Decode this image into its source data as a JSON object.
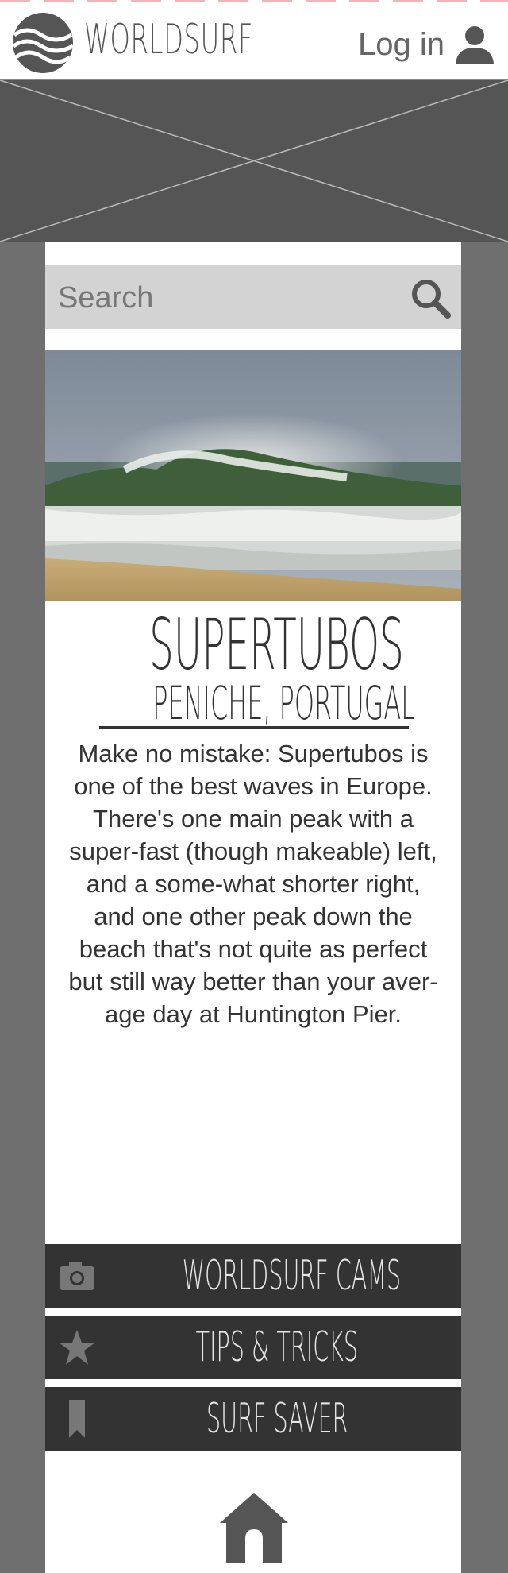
{
  "brand": {
    "name": "WORLDSURF"
  },
  "header": {
    "login_label": "Log in"
  },
  "search": {
    "placeholder": "Search"
  },
  "spot": {
    "name": "SUPERTUBOS",
    "location": "PENICHE, PORTUGAL",
    "description": "Make no mistake: Supertubos is one of the best waves in Europe. There's one main peak with a super-fast (though makeable) left, and a some-what shorter right, and one other peak down the beach that's not quite as perfect but still way better than your aver-age day at Huntington Pier."
  },
  "menu": [
    {
      "label": "WORLDSURF CAMS",
      "icon": "camera-icon"
    },
    {
      "label": "TIPS & TRICKS",
      "icon": "star-icon"
    },
    {
      "label": "SURF SAVER",
      "icon": "bookmark-icon"
    }
  ],
  "footer": {
    "icon": "home-icon"
  },
  "colors": {
    "background": "#6f6f6f",
    "header": "#ffffff",
    "hero_placeholder": "#555555",
    "search_bar": "#d3d3d3",
    "menu_button": "#333333",
    "menu_text": "#e6e6e6"
  }
}
